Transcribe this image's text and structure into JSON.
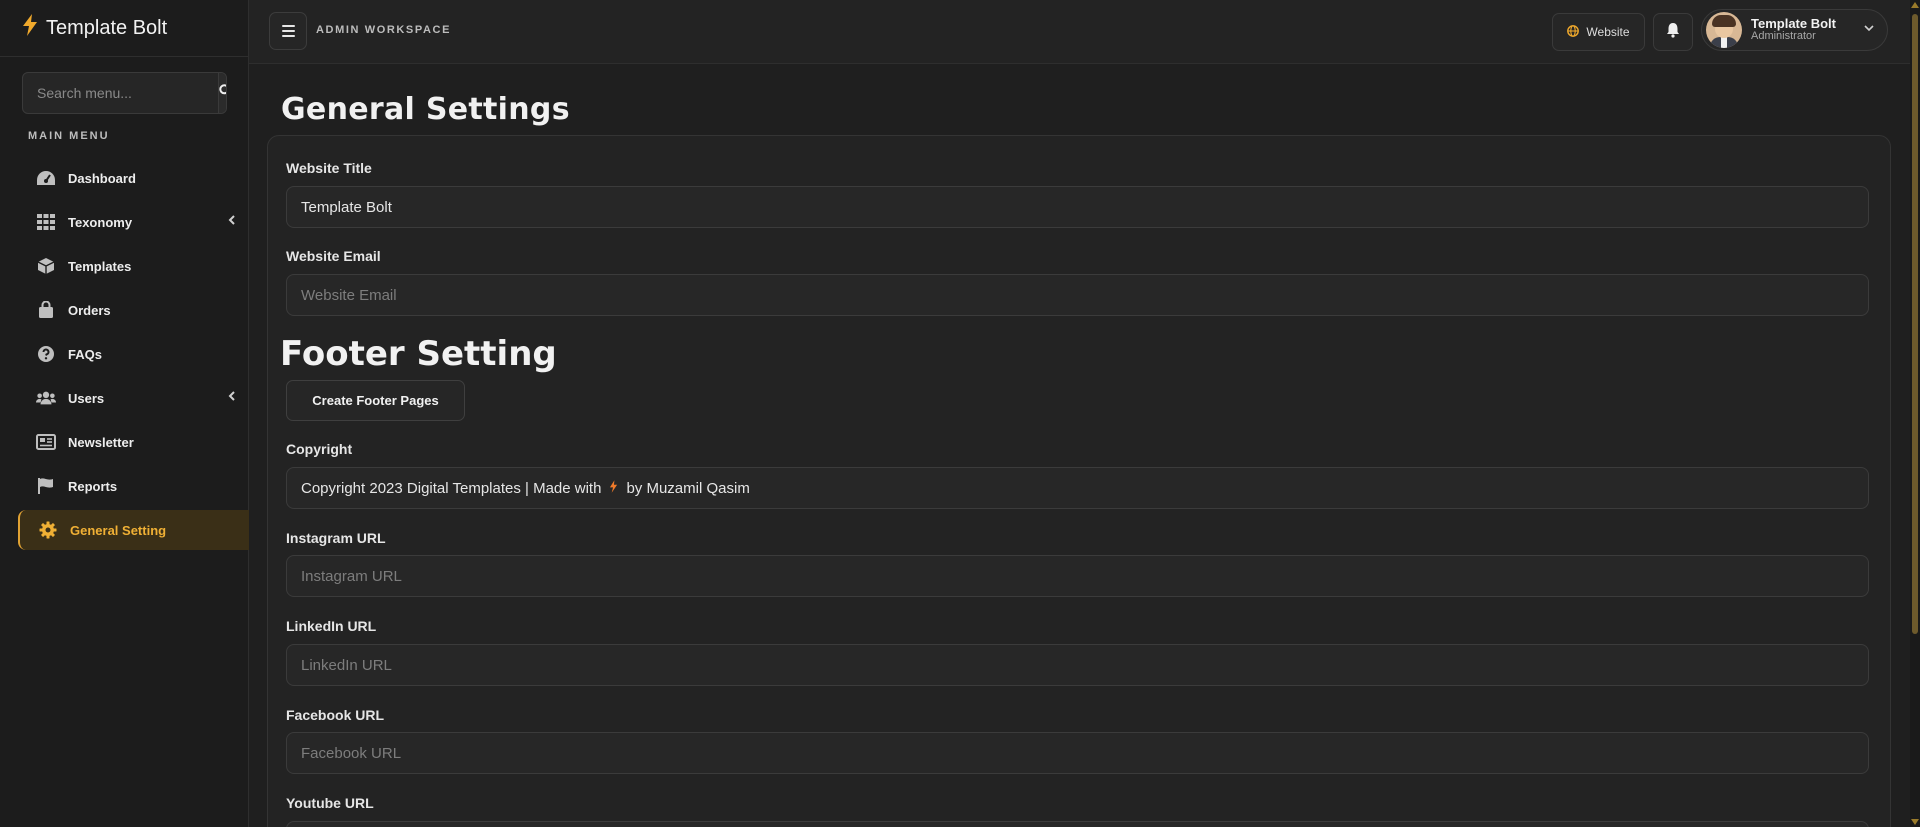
{
  "app": {
    "brand": "Template Bolt"
  },
  "sidebar": {
    "search_placeholder": "Search menu...",
    "section_label": "MAIN MENU",
    "items": [
      {
        "label": "Dashboard",
        "icon": "gauge-icon"
      },
      {
        "label": "Texonomy",
        "icon": "grid-icon",
        "has_submenu": true
      },
      {
        "label": "Templates",
        "icon": "cube-icon"
      },
      {
        "label": "Orders",
        "icon": "shopping-bag-icon"
      },
      {
        "label": "FAQs",
        "icon": "question-circle-icon"
      },
      {
        "label": "Users",
        "icon": "users-icon",
        "has_submenu": true
      },
      {
        "label": "Newsletter",
        "icon": "newspaper-icon"
      },
      {
        "label": "Reports",
        "icon": "flag-icon"
      },
      {
        "label": "General Setting",
        "icon": "gear-icon",
        "active": true
      }
    ]
  },
  "topbar": {
    "workspace_label": "ADMIN WORKSPACE",
    "website_button": "Website",
    "user": {
      "name": "Template Bolt",
      "role": "Administrator"
    }
  },
  "page": {
    "title": "General Settings",
    "fields": {
      "website_title": {
        "label": "Website Title",
        "value": "Template Bolt"
      },
      "website_email": {
        "label": "Website Email",
        "placeholder": "Website Email"
      }
    },
    "footer": {
      "title": "Footer Setting",
      "create_button": "Create Footer Pages",
      "copyright": {
        "label": "Copyright",
        "value_before": "Copyright 2023 Digital Templates | Made with",
        "value_after": "by Muzamil Qasim"
      },
      "instagram": {
        "label": "Instagram URL",
        "placeholder": "Instagram URL"
      },
      "linkedin": {
        "label": "LinkedIn URL",
        "placeholder": "LinkedIn URL"
      },
      "facebook": {
        "label": "Facebook URL",
        "placeholder": "Facebook URL"
      },
      "youtube": {
        "label": "Youtube URL"
      }
    }
  },
  "colors": {
    "accent": "#f0a92c",
    "active_bg": "#3a2f17",
    "background": "#1f1f1f",
    "copyright_bolt": "#f07a2a"
  }
}
